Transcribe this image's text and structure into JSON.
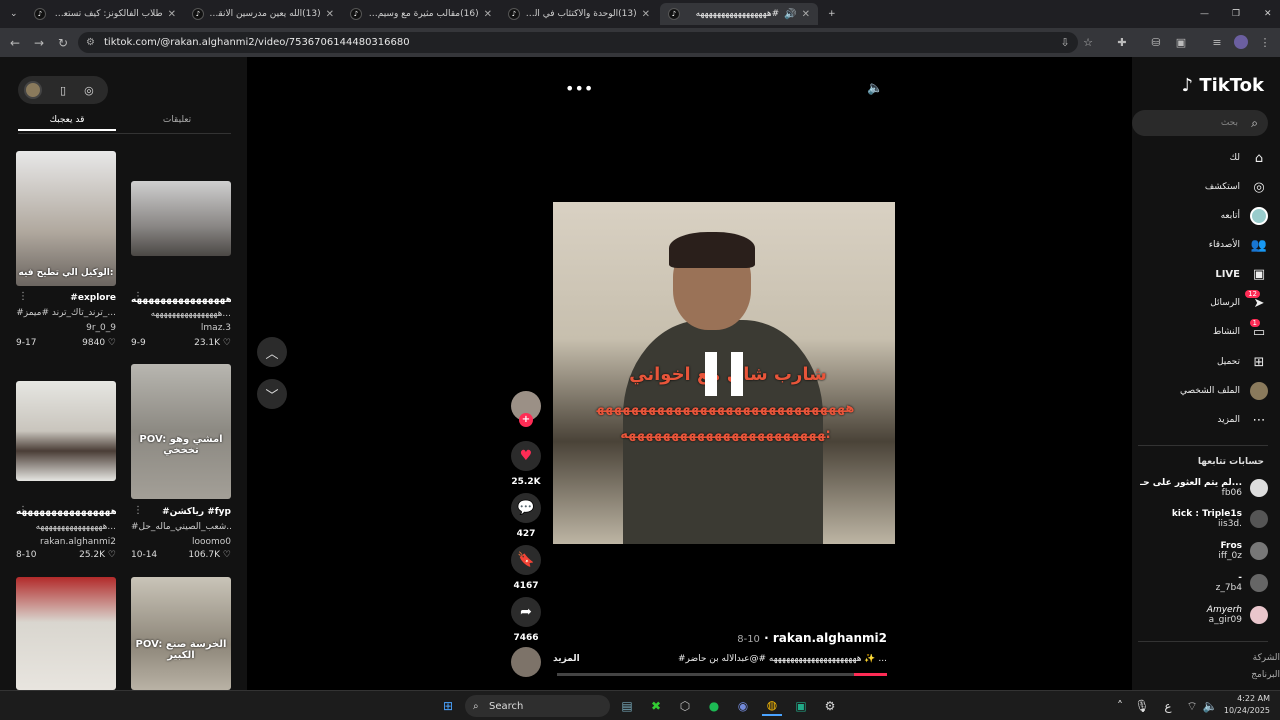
{
  "browser": {
    "tabs": [
      {
        "title": "طلاب الفالكونز: كيف تستعد للاختبارات"
      },
      {
        "title": "(13)الله يعين مدرسين الانقليزي 😂"
      },
      {
        "title": "(16)مقالب مثيرة مع وسيم وطائر"
      },
      {
        "title": "(13)الوحدة والاكتئاب في السيارة"
      },
      {
        "title": "#هههههههههههههههههه"
      }
    ],
    "url": "tiktok.com/@rakan.alghanmi2/video/7536706144480316680"
  },
  "left_panel": {
    "tabs": {
      "for_you": "قد يعجبك",
      "comments": "تعليقات"
    },
    "videos": [
      {
        "overlay": "الوكيل الي تطيح فيه:",
        "title": "#explore",
        "subtitle": "#ترند_تاك_ترند #ميمز_...",
        "author": "9r_0_9",
        "likes": "9840",
        "date": "9-17"
      },
      {
        "overlay": "",
        "title": "ههههههههههههههههه#",
        "subtitle": "ههههههههههههههههه...",
        "author": "lmaz.3",
        "likes": "23.1K",
        "date": "9-9"
      },
      {
        "overlay": "",
        "title": "ههههههههههههههههه#",
        "subtitle": "ههههههههههههههههه...",
        "author": "rakan.alghanmi2",
        "likes": "25.2K",
        "date": "8-10"
      },
      {
        "overlay": "POV: امشي وهو تخخخي",
        "title": "#رياكشن #fyp",
        "subtitle": "#شعب_الصيني_ماله_حل...",
        "author": "looomo0",
        "likes": "106.7K",
        "date": "10-14"
      },
      {
        "overlay": "",
        "title": "",
        "subtitle": "",
        "author": "",
        "likes": "",
        "date": ""
      },
      {
        "overlay": "POV: الخرسة صنع الكبير",
        "title": "",
        "subtitle": "",
        "author": "",
        "likes": "",
        "date": ""
      }
    ]
  },
  "video": {
    "overlay_line1": "شارب شاي مع اخواني",
    "overlay_line2": "هههههههههههههههههههههههههههههههههههههههههههههههههههههه:",
    "likes": "25.2K",
    "comments": "427",
    "saves": "4167",
    "shares": "7466",
    "author": "rakan.alghanmi2",
    "date": "8-10",
    "description": "#هههههههههههههههههههههه #@عبدالاله بن حاضر ✨ ...",
    "more": "المزيد",
    "progress": 0.1
  },
  "right_nav": {
    "logo": "TikTok",
    "search_placeholder": "بحث",
    "items": [
      {
        "label": "لك",
        "icon": "home-icon"
      },
      {
        "label": "استكشف",
        "icon": "compass-icon"
      },
      {
        "label": "أتابعه",
        "icon": "following-icon"
      },
      {
        "label": "الأصدقاء",
        "icon": "friends-icon"
      },
      {
        "label": "LIVE",
        "icon": "live-icon"
      },
      {
        "label": "الرسائل",
        "icon": "messages-icon",
        "badge": "12"
      },
      {
        "label": "النشاط",
        "icon": "activity-icon",
        "badge": "1"
      },
      {
        "label": "تحميل",
        "icon": "upload-icon"
      },
      {
        "label": "الملف الشخصي",
        "icon": "profile-icon"
      },
      {
        "label": "المزيد",
        "icon": "more-icon"
      }
    ],
    "following_title": "حسابات تتابعها",
    "following": [
      {
        "name": "لم يتم العثور على حـ...",
        "handle": "fb06"
      },
      {
        "name": "kick : Triple1s",
        "handle": "iis3d."
      },
      {
        "name": "Fros",
        "handle": "iff_0z"
      },
      {
        "name": "-",
        "handle": "z_7b4"
      },
      {
        "name": "Amyerh",
        "handle": "a_gir09"
      }
    ],
    "footer": [
      "الشركة",
      "البرنامج"
    ]
  },
  "taskbar": {
    "search": "Search",
    "time": "4:22 AM",
    "date": "10/24/2025"
  }
}
